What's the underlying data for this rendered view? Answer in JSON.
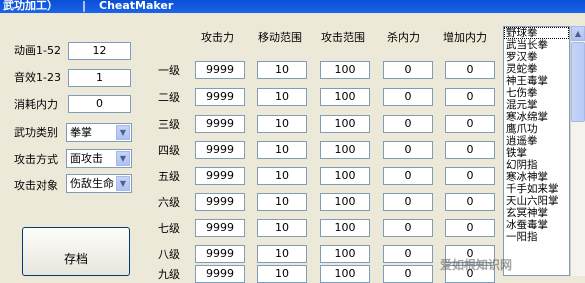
{
  "window": {
    "title_left": "武功加工）",
    "title_separator": "|",
    "title_right": "CheatMaker"
  },
  "left_panel": {
    "anim_label": "动画1-52",
    "anim_value": "12",
    "sound_label": "音效1-23",
    "sound_value": "1",
    "cost_label": "消耗内力",
    "cost_value": "0",
    "category_label": "武功类别",
    "category_value": "拳掌",
    "attack_mode_label": "攻击方式",
    "attack_mode_value": "面攻击",
    "target_label": "攻击对象",
    "target_value": "伤敌生命",
    "save_button": "存档"
  },
  "table": {
    "headers": [
      "攻击力",
      "移动范围",
      "攻击范围",
      "杀内力",
      "增加内力"
    ],
    "rows": [
      {
        "label": "一级",
        "values": [
          "9999",
          "10",
          "100",
          "0",
          "0"
        ]
      },
      {
        "label": "二级",
        "values": [
          "9999",
          "10",
          "100",
          "0",
          "0"
        ]
      },
      {
        "label": "三级",
        "values": [
          "9999",
          "10",
          "100",
          "0",
          "0"
        ]
      },
      {
        "label": "四级",
        "values": [
          "9999",
          "10",
          "100",
          "0",
          "0"
        ]
      },
      {
        "label": "五级",
        "values": [
          "9999",
          "10",
          "100",
          "0",
          "0"
        ]
      },
      {
        "label": "六级",
        "values": [
          "9999",
          "10",
          "100",
          "0",
          "0"
        ]
      },
      {
        "label": "七级",
        "values": [
          "9999",
          "10",
          "100",
          "0",
          "0"
        ]
      },
      {
        "label": "八级",
        "values": [
          "9999",
          "10",
          "100",
          "0",
          "0"
        ]
      },
      {
        "label": "九级",
        "values": [
          "9999",
          "10",
          "100",
          "0",
          "0"
        ]
      }
    ]
  },
  "skill_list": {
    "selected_index": 0,
    "items": [
      "野球拳",
      "武当长拳",
      "罗汉拳",
      "灵蛇拳",
      "神王毒掌",
      "七伤拳",
      "混元掌",
      "寒冰绵掌",
      "鹰爪功",
      "逍遥拳",
      "铁掌",
      "幻阴指",
      "寒冰神掌",
      "千手如来掌",
      "天山六阳掌",
      "玄冥神掌",
      "冰蚕毒掌",
      "一阳指"
    ]
  },
  "watermark": "爱如根知识网"
}
